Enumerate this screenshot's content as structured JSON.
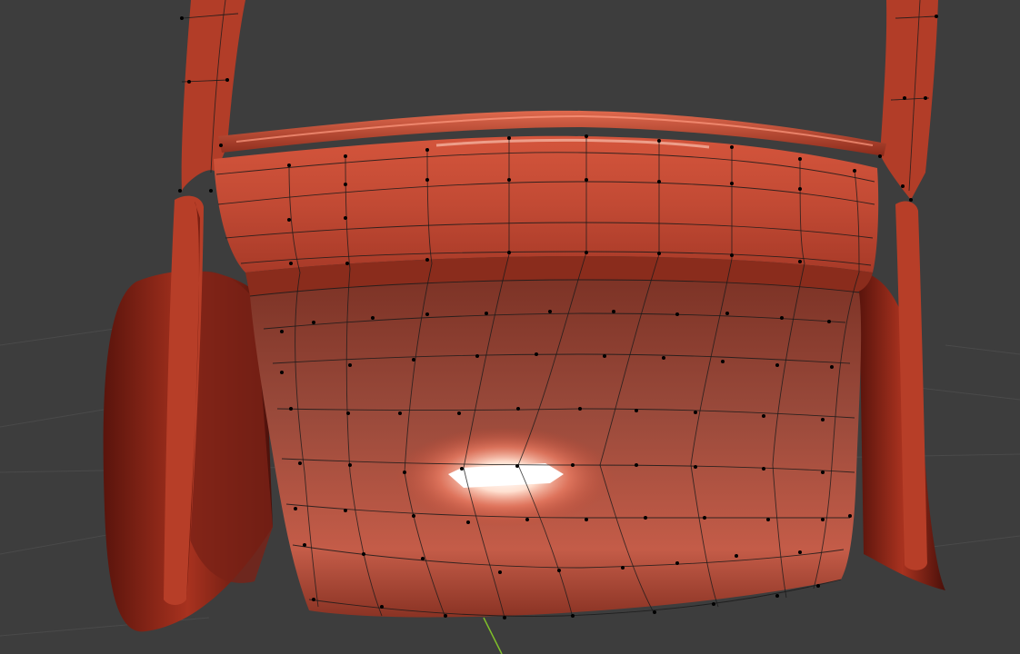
{
  "viewport": {
    "background_color": "#3d3d3d",
    "grid_color": "#4a4a4a",
    "y_axis_color": "#7fbf2a"
  },
  "model": {
    "material_base_color": "#c2452f",
    "material_dark_color": "#6a1d12",
    "material_highlight_color": "#ffffff",
    "wire_color": "#1a1a1a",
    "vertex_color": "#000000"
  }
}
